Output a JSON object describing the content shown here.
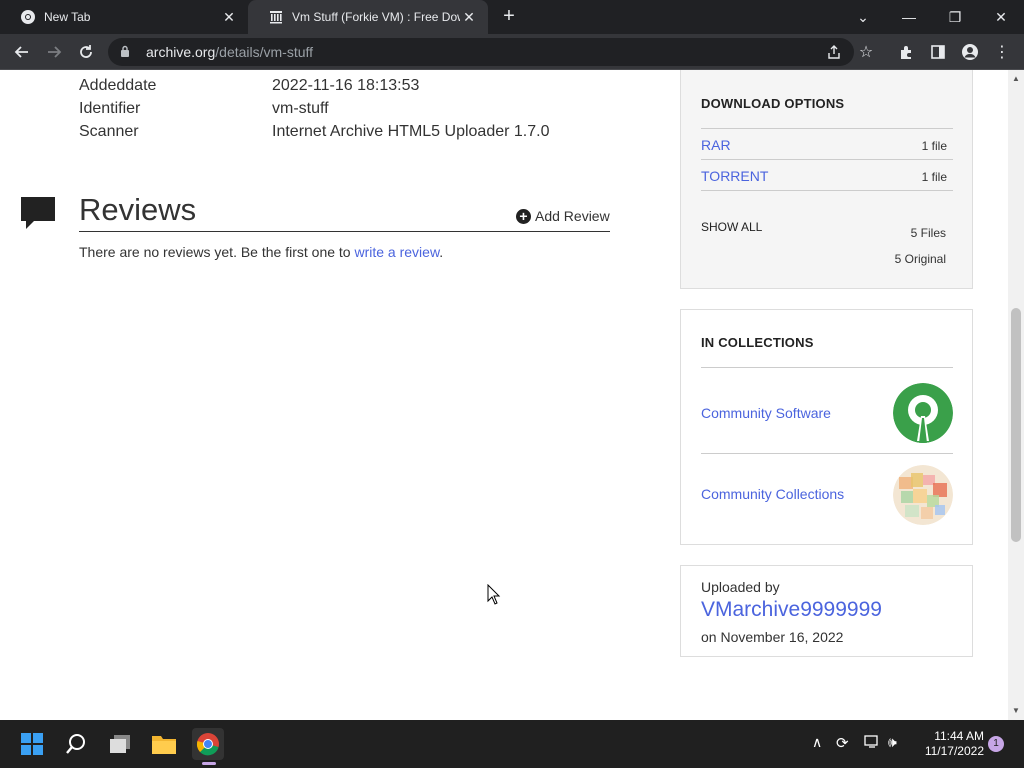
{
  "browser": {
    "tabs": [
      {
        "title": "New Tab",
        "icon": "chrome-icon"
      },
      {
        "title": "Vm Stuff (Forkie VM) : Free Down",
        "icon": "archive-icon"
      }
    ],
    "new_tab_label": "+",
    "url_host": "archive.org",
    "url_path": "/details/vm-stuff"
  },
  "metadata": {
    "rows": [
      {
        "label": "Addeddate",
        "value": "2022-11-16 18:13:53"
      },
      {
        "label": "Identifier",
        "value": "vm-stuff"
      },
      {
        "label": "Scanner",
        "value": "Internet Archive HTML5 Uploader 1.7.0"
      }
    ]
  },
  "reviews": {
    "title": "Reviews",
    "add_label": "Add Review",
    "empty_text": "There are no reviews yet. Be the first one to ",
    "write_link": "write a review",
    "empty_suffix": "."
  },
  "download_options": {
    "title": "DOWNLOAD OPTIONS",
    "items": [
      {
        "label": "RAR",
        "count": "1 file"
      },
      {
        "label": "TORRENT",
        "count": "1 file"
      }
    ],
    "show_all": "SHOW ALL",
    "files_count": "5 Files",
    "original_count": "5 Original"
  },
  "collections": {
    "title": "IN COLLECTIONS",
    "items": [
      {
        "label": "Community Software"
      },
      {
        "label": "Community Collections"
      }
    ]
  },
  "uploader": {
    "label": "Uploaded by",
    "name": "VMarchive9999999",
    "date": "on November 16, 2022"
  },
  "taskbar": {
    "time": "11:44 AM",
    "date": "11/17/2022",
    "notification_count": "1"
  },
  "colors": {
    "link": "#4b64de",
    "chrome_dark": "#202124",
    "taskbar": "#202020"
  }
}
